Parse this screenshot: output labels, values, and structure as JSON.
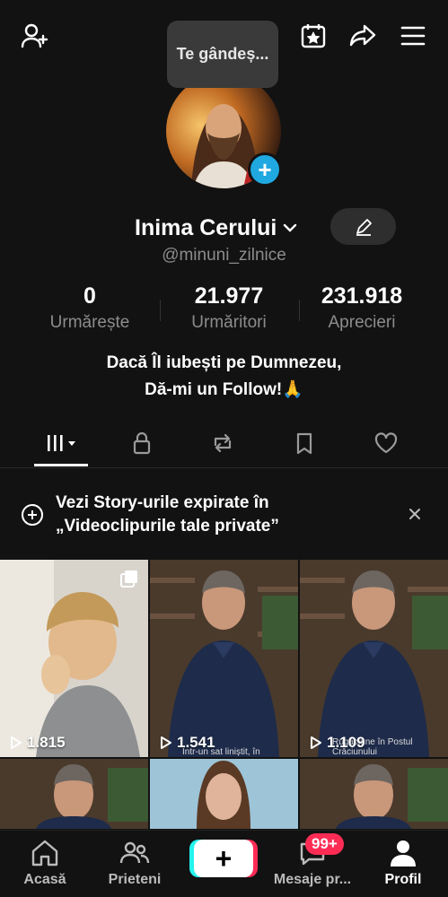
{
  "tooltip": {
    "text": "Te gândeș..."
  },
  "profile": {
    "display_name": "Inima Cerului",
    "username": "@minuni_zilnice",
    "bio_line1": "Dacă Îl iubești pe Dumnezeu,",
    "bio_line2": "Dă-mi un Follow!🙏"
  },
  "stats": [
    {
      "value": "0",
      "label": "Urmărește"
    },
    {
      "value": "21.977",
      "label": "Urmăritori"
    },
    {
      "value": "231.918",
      "label": "Aprecieri"
    }
  ],
  "banner": {
    "line1": "Vezi Story-urile expirate în",
    "line2": "„Videoclipurile tale private”"
  },
  "videos": [
    {
      "views": "1.815",
      "caption": ""
    },
    {
      "views": "1.541",
      "caption": "Într-un sat liniștit, în"
    },
    {
      "views": "1.109",
      "caption": "Rugăciune în Postul Crăciunului"
    }
  ],
  "nav": {
    "home": "Acasă",
    "friends": "Prieteni",
    "messages": "Mesaje pr...",
    "messages_badge": "99+",
    "profile": "Profil"
  },
  "colors": {
    "accent_blue": "#20a8e0",
    "badge_red": "#fe2c55",
    "cyan": "#25f4ee"
  }
}
